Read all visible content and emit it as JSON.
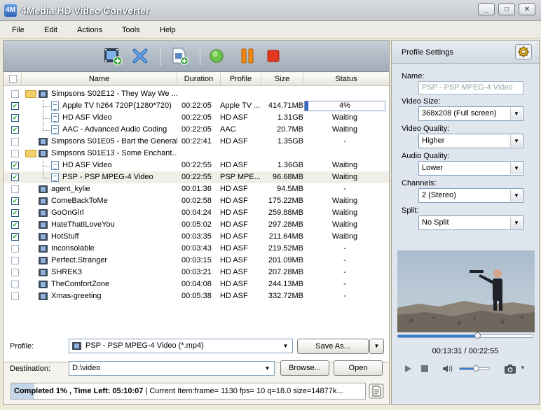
{
  "window": {
    "title": "4Media HD Video Converter",
    "app_icon": "4M",
    "minimize": "_",
    "maximize": "□",
    "close": "✕"
  },
  "menu": [
    "File",
    "Edit",
    "Actions",
    "Tools",
    "Help"
  ],
  "toolbar": {
    "icons": [
      "add-video-icon",
      "remove-icon",
      "add-profile-icon",
      "start-icon",
      "pause-icon",
      "stop-icon"
    ]
  },
  "columns": {
    "name": "Name",
    "duration": "Duration",
    "profile": "Profile",
    "size": "Size",
    "status": "Status"
  },
  "rows": [
    {
      "kind": "group",
      "checked": false,
      "name": "Simpsons S02E12 - They Way We ...",
      "duration": "",
      "profile": "",
      "size": "",
      "status": ""
    },
    {
      "kind": "child",
      "checked": true,
      "name": "Apple TV h264 720P(1280*720)",
      "duration": "00:22:05",
      "profile": "Apple TV ...",
      "size": "414.71MB",
      "status": "4%",
      "progress": 0.04
    },
    {
      "kind": "child",
      "checked": true,
      "name": "HD ASF Video",
      "duration": "00:22:05",
      "profile": "HD ASF",
      "size": "1.31GB",
      "status": "Waiting"
    },
    {
      "kind": "childlast",
      "checked": true,
      "name": "AAC - Advanced Audio Coding",
      "duration": "00:22:05",
      "profile": "AAC",
      "size": "20.7MB",
      "status": "Waiting"
    },
    {
      "kind": "file",
      "checked": false,
      "name": "Simpsons S01E05 - Bart the General",
      "duration": "00:22:41",
      "profile": "HD ASF",
      "size": "1.35GB",
      "status": "-"
    },
    {
      "kind": "group",
      "checked": false,
      "name": "Simpsons S01E13 - Some Enchant...",
      "duration": "",
      "profile": "",
      "size": "",
      "status": ""
    },
    {
      "kind": "child",
      "checked": true,
      "name": "HD ASF Video",
      "duration": "00:22:55",
      "profile": "HD ASF",
      "size": "1.36GB",
      "status": "Waiting"
    },
    {
      "kind": "childlast",
      "checked": true,
      "selected": true,
      "name": "PSP - PSP MPEG-4 Video",
      "duration": "00:22:55",
      "profile": "PSP MPE...",
      "size": "96.68MB",
      "status": "Waiting"
    },
    {
      "kind": "file",
      "checked": false,
      "name": "agent_kylie",
      "duration": "00:01:36",
      "profile": "HD ASF",
      "size": "94.5MB",
      "status": "-"
    },
    {
      "kind": "file",
      "checked": true,
      "name": "ComeBackToMe",
      "duration": "00:02:58",
      "profile": "HD ASF",
      "size": "175.22MB",
      "status": "Waiting"
    },
    {
      "kind": "file",
      "checked": true,
      "name": "GoOnGirl",
      "duration": "00:04:24",
      "profile": "HD ASF",
      "size": "259.88MB",
      "status": "Waiting"
    },
    {
      "kind": "file",
      "checked": true,
      "name": "HateThatILoveYou",
      "duration": "00:05:02",
      "profile": "HD ASF",
      "size": "297.28MB",
      "status": "Waiting"
    },
    {
      "kind": "file",
      "checked": true,
      "name": "HotStuff",
      "duration": "00:03:35",
      "profile": "HD ASF",
      "size": "211.64MB",
      "status": "Waiting"
    },
    {
      "kind": "file",
      "checked": false,
      "name": "Inconsolable",
      "duration": "00:03:43",
      "profile": "HD ASF",
      "size": "219.52MB",
      "status": "-"
    },
    {
      "kind": "file",
      "checked": false,
      "name": "Perfect.Stranger",
      "duration": "00:03:15",
      "profile": "HD ASF",
      "size": "201.09MB",
      "status": "-"
    },
    {
      "kind": "file",
      "checked": false,
      "name": "SHREK3",
      "duration": "00:03:21",
      "profile": "HD ASF",
      "size": "207.28MB",
      "status": "-"
    },
    {
      "kind": "file",
      "checked": false,
      "name": "TheComfortZone",
      "duration": "00:04:08",
      "profile": "HD ASF",
      "size": "244.13MB",
      "status": "-"
    },
    {
      "kind": "file",
      "checked": false,
      "name": "Xmas-greeting",
      "duration": "00:05:38",
      "profile": "HD ASF",
      "size": "332.72MB",
      "status": "-"
    }
  ],
  "bottom": {
    "profile_label": "Profile:",
    "profile_value": "PSP - PSP MPEG-4 Video (*.mp4)",
    "save_as": "Save As...",
    "destination_label": "Destination:",
    "destination_value": "D:\\video",
    "browse": "Browse...",
    "open": "Open",
    "status_bold": "Completed 1% , Time Left: 05:10:07",
    "status_rest": " | Current Item:frame= 1130 fps= 10 q=18.0 size=14877k...",
    "overall_progress": 0.01
  },
  "profile_settings": {
    "title": "Profile Settings",
    "name_label": "Name:",
    "name_value": "PSP - PSP MPEG-4 Video",
    "video_size_label": "Video Size:",
    "video_size": "368x208 (Full screen)",
    "video_quality_label": "Video Quality:",
    "video_quality": "Higher",
    "audio_quality_label": "Audio Quality:",
    "audio_quality": "Lower",
    "channels_label": "Channels:",
    "channels": "2 (Stereo)",
    "split_label": "Split:",
    "split": "No Split"
  },
  "player": {
    "time": "00:13:31 / 00:22:55",
    "position": 0.59,
    "volume": 0.55
  },
  "colors": {
    "accent": "#3569c6",
    "title_text": "#ffffff",
    "selected_row": "#efeee7"
  }
}
